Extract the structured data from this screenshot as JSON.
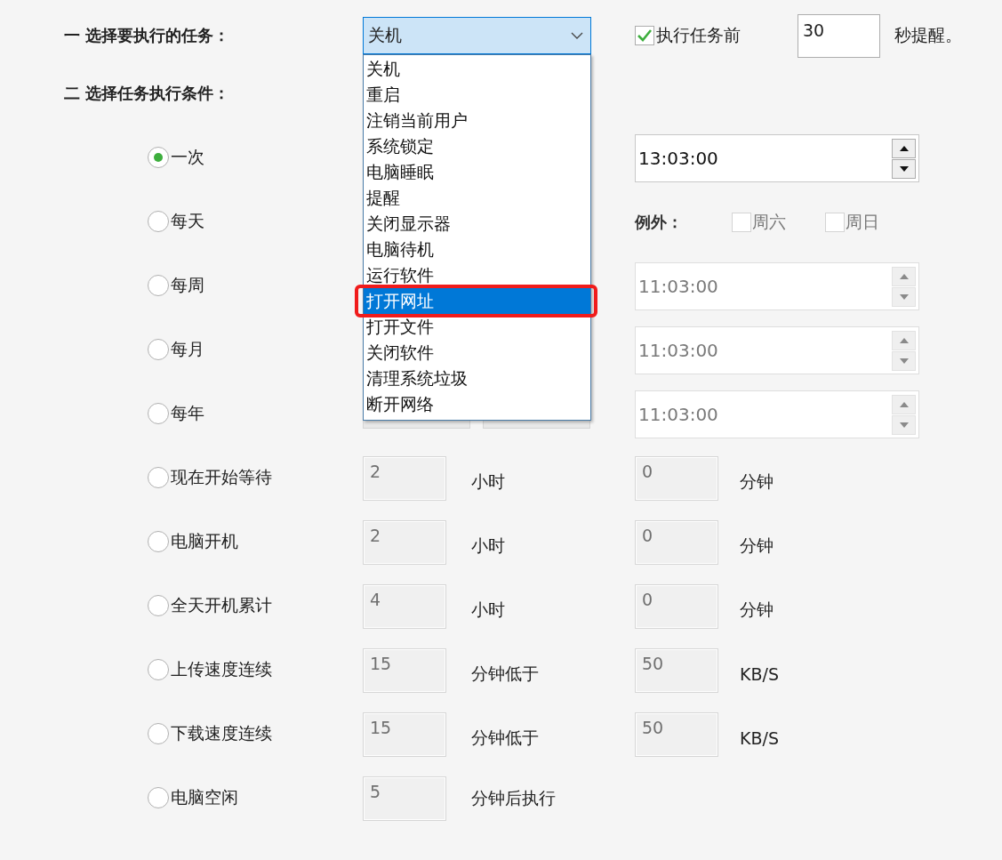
{
  "task_heading": "一 选择要执行的任务：",
  "task": {
    "value": "关机",
    "expanded": true,
    "options": [
      {
        "label": "关机",
        "highlighted": false
      },
      {
        "label": "重启",
        "highlighted": false
      },
      {
        "label": "注销当前用户",
        "highlighted": false
      },
      {
        "label": "系统锁定",
        "highlighted": false
      },
      {
        "label": "电脑睡眠",
        "highlighted": false
      },
      {
        "label": "提醒",
        "highlighted": false
      },
      {
        "label": "关闭显示器",
        "highlighted": false
      },
      {
        "label": "电脑待机",
        "highlighted": false
      },
      {
        "label": "运行软件",
        "highlighted": false
      },
      {
        "label": "打开网址",
        "highlighted": true
      },
      {
        "label": "打开文件",
        "highlighted": false
      },
      {
        "label": "关闭软件",
        "highlighted": false
      },
      {
        "label": "清理系统垃圾",
        "highlighted": false
      },
      {
        "label": "断开网络",
        "highlighted": false
      }
    ]
  },
  "reminder": {
    "checked": true,
    "label": "执行任务前",
    "seconds": "30",
    "suffix": "秒提醒。"
  },
  "condition_heading": "二 选择任务执行条件：",
  "conditions": [
    {
      "kind": "time",
      "label": "一次",
      "selected": true,
      "time": {
        "value": "13:03:00",
        "disabled": false
      }
    },
    {
      "kind": "except",
      "label": "每天",
      "selected": false,
      "except_label": "例外：",
      "days": [
        {
          "label": "周六",
          "checked": false
        },
        {
          "label": "周日",
          "checked": false
        }
      ]
    },
    {
      "kind": "time",
      "label": "每周",
      "selected": false,
      "time": {
        "value": "11:03:00",
        "disabled": true
      }
    },
    {
      "kind": "time",
      "label": "每月",
      "selected": false,
      "time": {
        "value": "11:03:00",
        "disabled": true
      }
    },
    {
      "kind": "time",
      "label": "每年",
      "selected": false,
      "date_fields": true,
      "time": {
        "value": "11:03:00",
        "disabled": true
      }
    },
    {
      "kind": "pair",
      "label": "现在开始等待",
      "selected": false,
      "first": "2",
      "first_unit": "小时",
      "second": "0",
      "second_unit": "分钟"
    },
    {
      "kind": "pair",
      "label": "电脑开机",
      "selected": false,
      "first": "2",
      "first_unit": "小时",
      "second": "0",
      "second_unit": "分钟"
    },
    {
      "kind": "pair",
      "label": "全天开机累计",
      "selected": false,
      "first": "4",
      "first_unit": "小时",
      "second": "0",
      "second_unit": "分钟"
    },
    {
      "kind": "pair",
      "label": "上传速度连续",
      "selected": false,
      "first": "15",
      "first_unit": "分钟低于",
      "second": "50",
      "second_unit": "KB/S"
    },
    {
      "kind": "pair",
      "label": "下载速度连续",
      "selected": false,
      "first": "15",
      "first_unit": "分钟低于",
      "second": "50",
      "second_unit": "KB/S"
    },
    {
      "kind": "single",
      "label": "电脑空闲",
      "selected": false,
      "first": "5",
      "first_unit": "分钟后执行"
    }
  ]
}
